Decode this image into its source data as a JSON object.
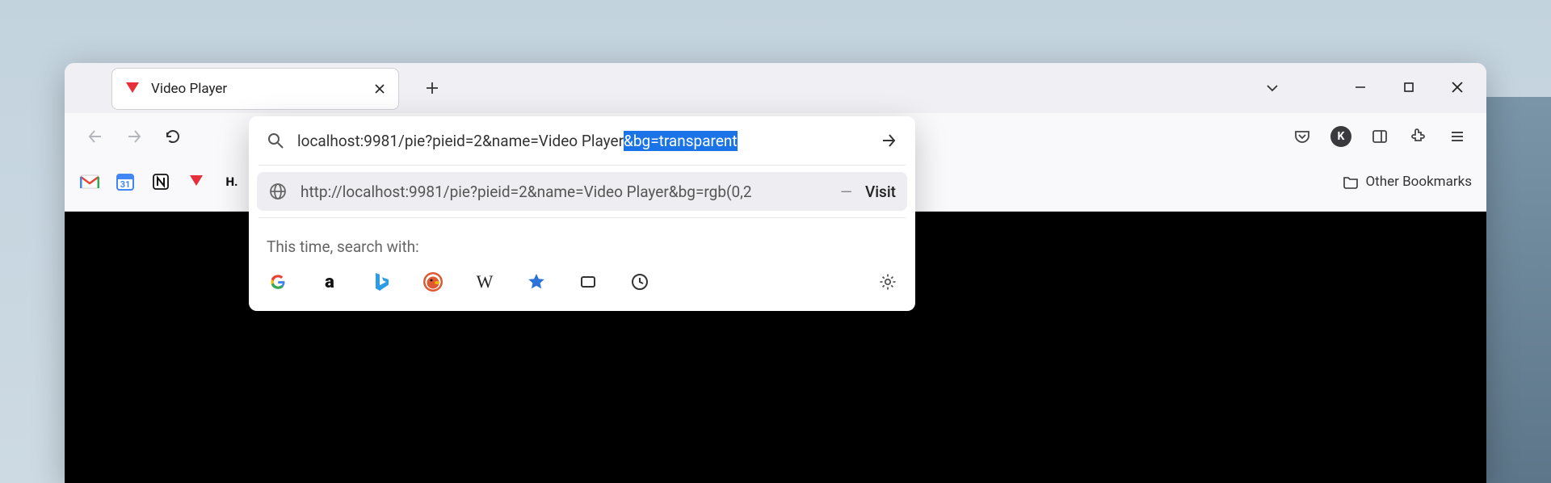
{
  "tab": {
    "title": "Video Player"
  },
  "urlbar": {
    "typed": "localhost:9981/pie?pieid=2&name=Video Player",
    "autocomplete": "&bg=transparent"
  },
  "suggestion": {
    "text": "http://localhost:9981/pie?pieid=2&name=Video Player&bg=rgb(0,2",
    "action": "Visit"
  },
  "search_with_label": "This time, search with:",
  "other_bookmarks_label": "Other Bookmarks",
  "engines": [
    "google",
    "amazon",
    "bing",
    "duckduckgo",
    "wikipedia",
    "bookmarks",
    "tabs",
    "history"
  ]
}
